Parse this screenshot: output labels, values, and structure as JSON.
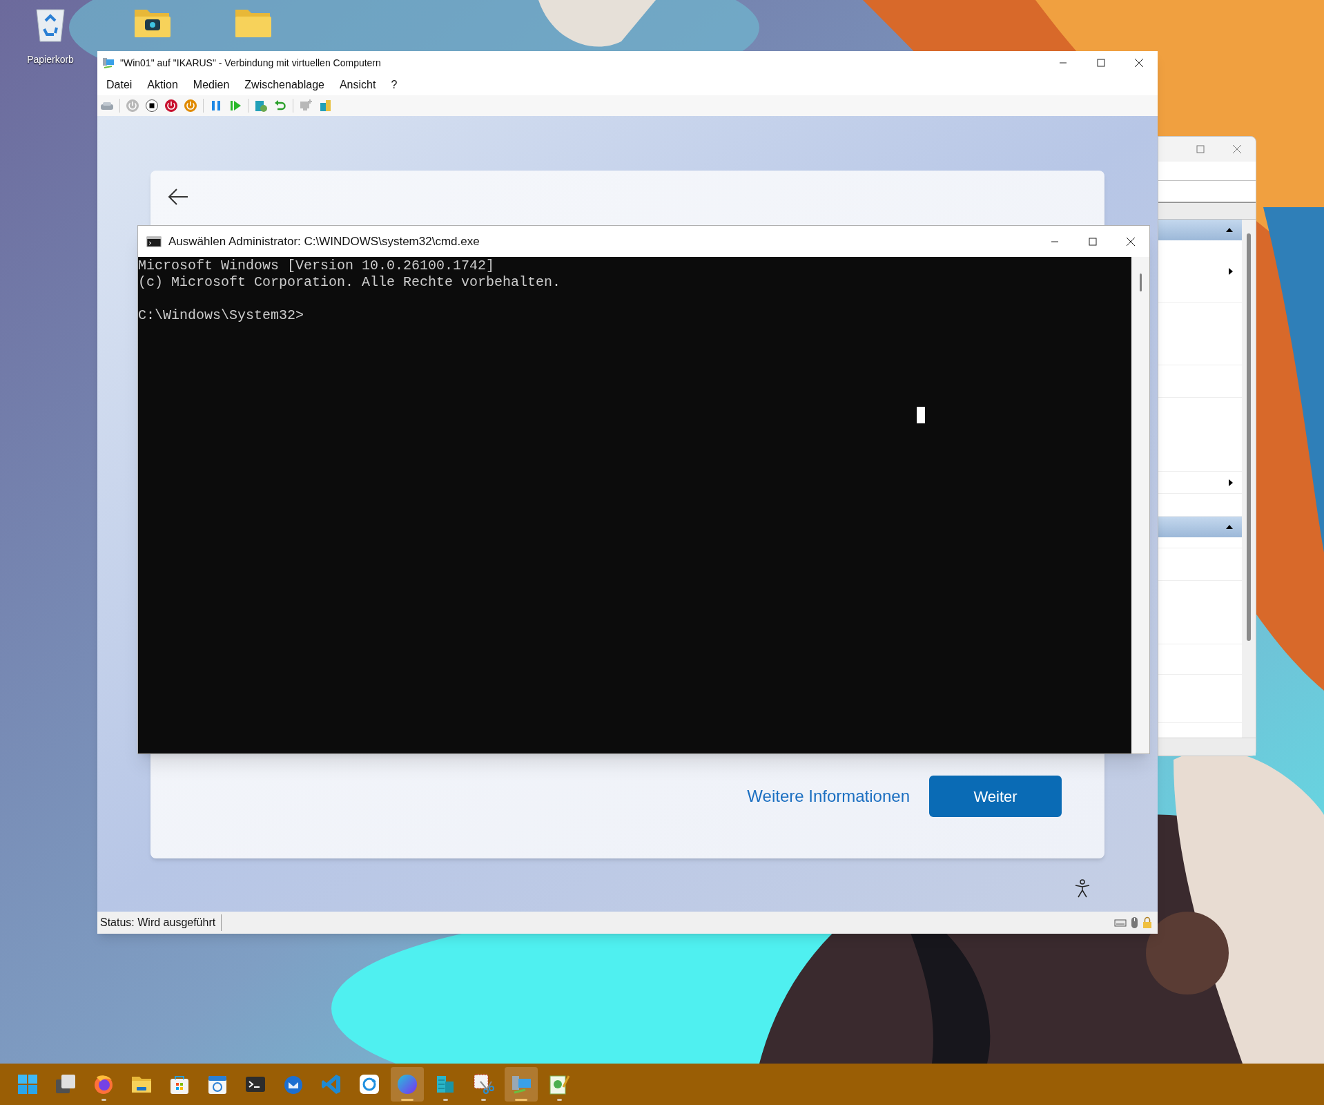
{
  "desktop_icons": [
    {
      "kind": "recycle-bin",
      "label": "Papierkorb"
    },
    {
      "kind": "folder-app"
    },
    {
      "kind": "folder"
    }
  ],
  "background_window": {
    "sections": [
      {
        "expanded": true,
        "rows": [
          {
            "kind": "submenu"
          },
          {
            "kind": "plain"
          },
          {
            "kind": "plain"
          },
          {
            "kind": "plain"
          },
          {
            "kind": "submenu"
          },
          {
            "kind": "plain"
          }
        ]
      },
      {
        "expanded": true,
        "rows": [
          {
            "kind": "plain"
          },
          {
            "kind": "plain"
          },
          {
            "kind": "plain"
          },
          {
            "kind": "plain"
          },
          {
            "kind": "plain"
          }
        ]
      }
    ]
  },
  "vm_window": {
    "title": "\"Win01\" auf \"IKARUS\" - Verbindung mit virtuellen Computern",
    "menu": [
      "Datei",
      "Aktion",
      "Medien",
      "Zwischenablage",
      "Ansicht",
      "?"
    ],
    "toolbar": [
      {
        "buttons": [
          {
            "kind": "ctrl-alt-del",
            "disabled": false
          }
        ]
      },
      {
        "buttons": [
          {
            "kind": "start",
            "disabled": true
          },
          {
            "kind": "turn-off",
            "disabled": false
          },
          {
            "kind": "shut-down",
            "disabled": false
          },
          {
            "kind": "save",
            "disabled": false
          }
        ]
      },
      {
        "buttons": [
          {
            "kind": "pause",
            "disabled": false
          },
          {
            "kind": "resume",
            "disabled": false
          }
        ]
      },
      {
        "buttons": [
          {
            "kind": "checkpoint",
            "disabled": false
          },
          {
            "kind": "revert",
            "disabled": false
          }
        ]
      },
      {
        "buttons": [
          {
            "kind": "enhanced-session",
            "disabled": true
          },
          {
            "kind": "share",
            "disabled": false
          }
        ]
      }
    ],
    "setup": {
      "buttons": [
        {
          "kind": "link",
          "label": "Weitere Informationen"
        },
        {
          "kind": "primary",
          "label": "Weiter"
        }
      ]
    },
    "console": {
      "title": "Auswählen Administrator: C:\\WINDOWS\\system32\\cmd.exe",
      "blocks": [
        [
          "Microsoft Windows [Version 10.0.26100.1742]",
          "(c) Microsoft Corporation. Alle Rechte vorbehalten."
        ],
        [
          "C:\\Windows\\System32>"
        ]
      ]
    },
    "status_bar": {
      "text": "Status: Wird ausgeführt"
    }
  },
  "taskbar": {
    "items": [
      {
        "kind": "start",
        "active": false,
        "running": false
      },
      {
        "kind": "task-view",
        "active": false,
        "running": false
      },
      {
        "kind": "firefox",
        "active": false,
        "running": true
      },
      {
        "kind": "explorer",
        "active": false,
        "running": false
      },
      {
        "kind": "store",
        "active": false,
        "running": false
      },
      {
        "kind": "calendar",
        "active": false,
        "running": false
      },
      {
        "kind": "terminal",
        "active": false,
        "running": false
      },
      {
        "kind": "mail",
        "active": false,
        "running": false
      },
      {
        "kind": "code",
        "active": false,
        "running": false
      },
      {
        "kind": "sync",
        "active": false,
        "running": false
      },
      {
        "kind": "canva",
        "active": true,
        "running": true
      },
      {
        "kind": "servers",
        "active": false,
        "running": true
      },
      {
        "kind": "snip",
        "active": false,
        "running": true
      },
      {
        "kind": "hyperv",
        "active": true,
        "running": true
      },
      {
        "kind": "notepad",
        "active": false,
        "running": true
      }
    ]
  }
}
